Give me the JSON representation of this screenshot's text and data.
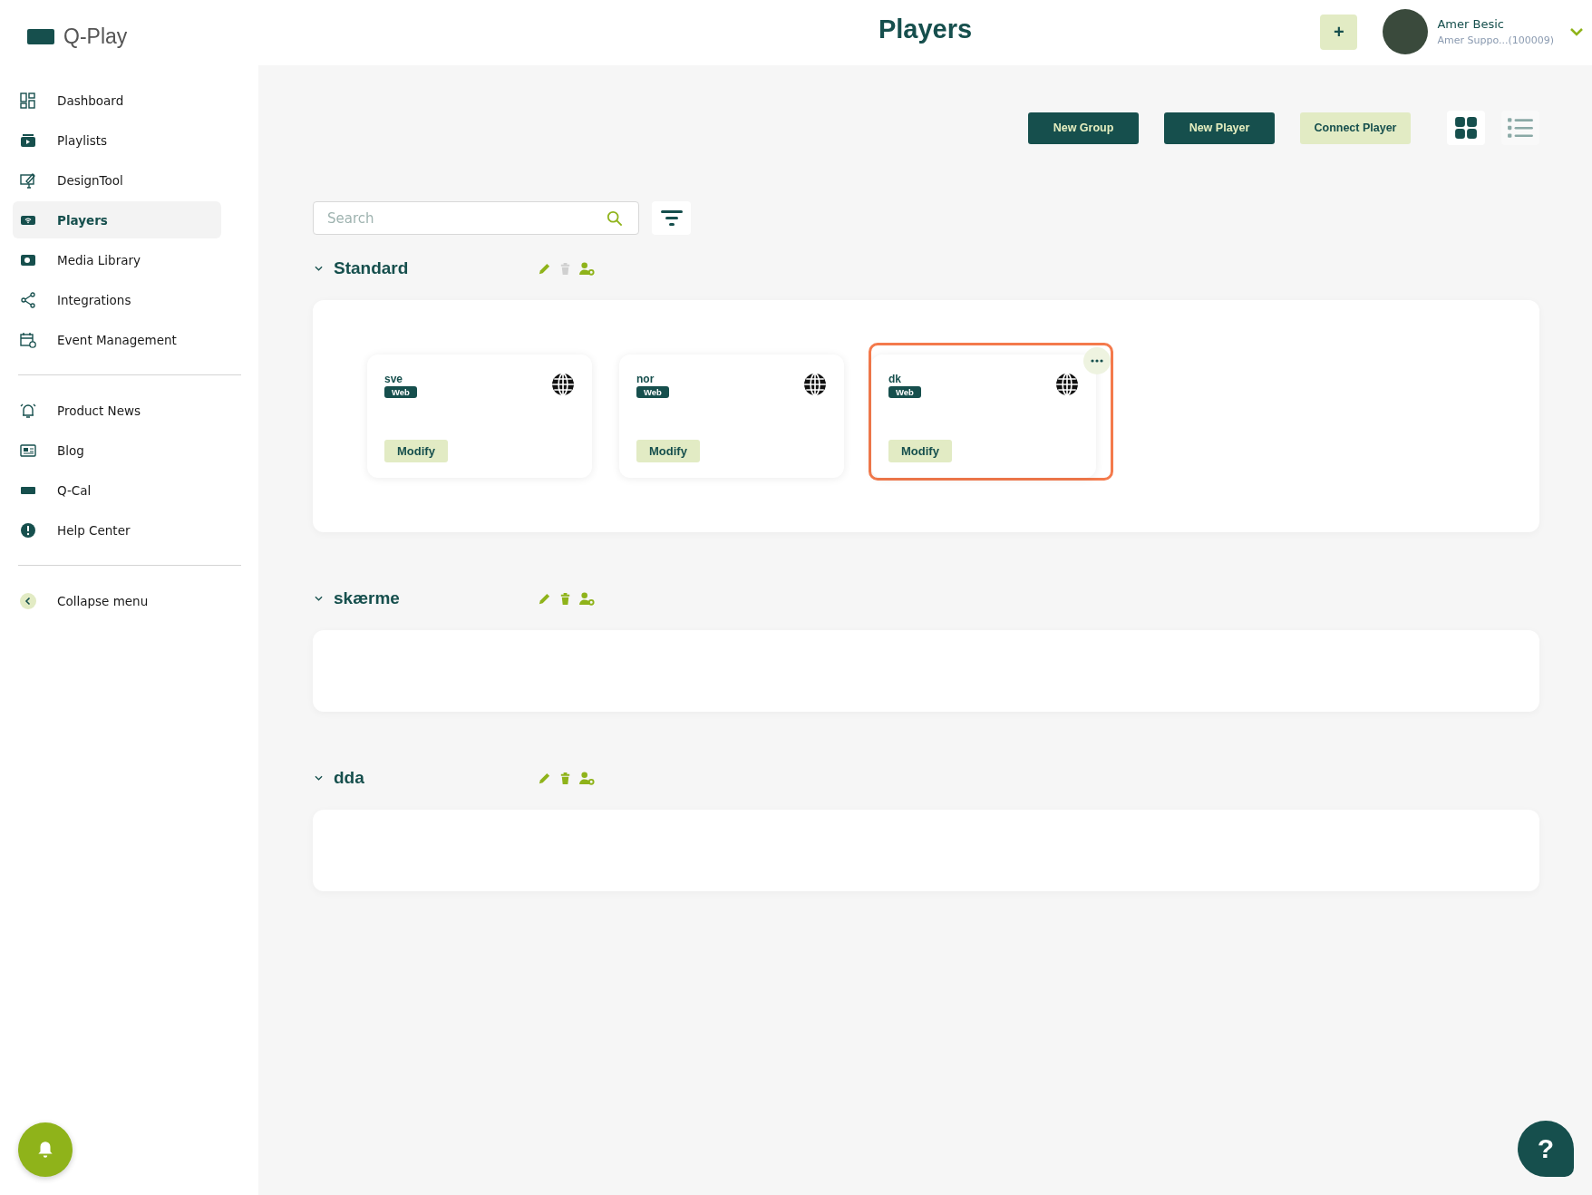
{
  "brand": {
    "name": "Q-Play"
  },
  "header": {
    "title": "Players",
    "add_button": "+",
    "user": {
      "name": "Amer Besic",
      "account": "Amer Suppo...(100009)"
    }
  },
  "sidebar": {
    "sections": [
      {
        "items": [
          {
            "label": "Dashboard",
            "selected": false
          },
          {
            "label": "Playlists",
            "selected": false
          },
          {
            "label": "DesignTool",
            "selected": false
          },
          {
            "label": "Players",
            "selected": true
          },
          {
            "label": "Media Library",
            "selected": false
          },
          {
            "label": "Integrations",
            "selected": false
          },
          {
            "label": "Event Management",
            "selected": false
          }
        ]
      },
      {
        "items": [
          {
            "label": "Product News",
            "selected": false
          },
          {
            "label": "Blog",
            "selected": false
          },
          {
            "label": "Q-Cal",
            "selected": false
          },
          {
            "label": "Help Center",
            "selected": false
          }
        ]
      },
      {
        "items": [
          {
            "label": "Collapse menu",
            "selected": false
          }
        ]
      }
    ]
  },
  "toolbar": {
    "buttons": [
      {
        "label": "New Group",
        "kind": "primary"
      },
      {
        "label": "New Player",
        "kind": "primary"
      },
      {
        "label": "Connect Player",
        "kind": "secondary"
      }
    ],
    "views": [
      {
        "kind": "grid",
        "selected": true
      },
      {
        "kind": "list",
        "selected": false
      }
    ]
  },
  "search": {
    "placeholder": "Search"
  },
  "groups": [
    {
      "name": "Standard",
      "expanded": true,
      "delete_disabled": true,
      "players": [
        {
          "name": "sve",
          "tag": "Web",
          "action": "Modify",
          "highlighted": false
        },
        {
          "name": "nor",
          "tag": "Web",
          "action": "Modify",
          "highlighted": false
        },
        {
          "name": "dk",
          "tag": "Web",
          "action": "Modify",
          "highlighted": true
        }
      ]
    },
    {
      "name": "skærme",
      "expanded": true,
      "delete_disabled": false
    },
    {
      "name": "dda",
      "expanded": true,
      "delete_disabled": false
    }
  ],
  "help_button": "?"
}
